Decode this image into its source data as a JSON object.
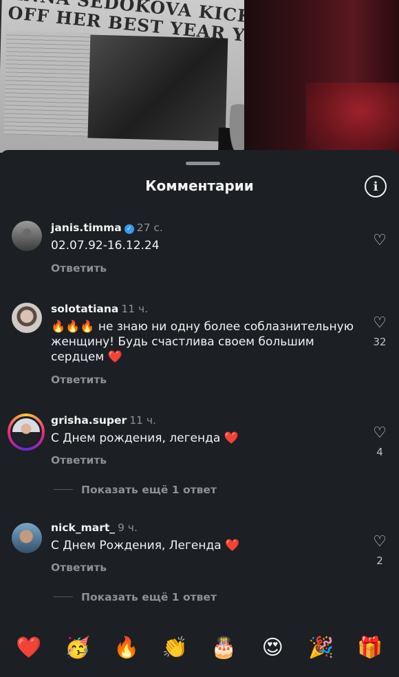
{
  "video": {
    "headline": "ANNA SEDOKOVA KICKS\nOFF HER BEST YEAR YET"
  },
  "sheet": {
    "title": "Комментарии",
    "info_icon": "info-icon"
  },
  "comments": [
    {
      "username": "janis.timma",
      "verified": true,
      "time": "27 с.",
      "text": "02.07.92-16.12.24",
      "reply_label": "Ответить",
      "likes": ""
    },
    {
      "username": "solotatiana",
      "verified": false,
      "time": "11 ч.",
      "text_prefix": "🔥🔥🔥",
      "text": " не знаю ни одну более соблазнительную женщину! Будь счастлива своем большим сердцем ",
      "text_suffix": "❤️",
      "reply_label": "Ответить",
      "likes": "32"
    },
    {
      "username": "grisha.super",
      "verified": false,
      "time": "11 ч.",
      "text": "С Днем рождения, легенда ",
      "text_suffix": "❤️",
      "reply_label": "Ответить",
      "likes": "4",
      "more_replies": "Показать ещё 1 ответ"
    },
    {
      "username": "nick_mart_",
      "verified": false,
      "time": "9 ч.",
      "text": "С Днем Рождения, Легенда ",
      "text_suffix": "❤️",
      "reply_label": "Ответить",
      "likes": "2",
      "more_replies": "Показать ещё 1 ответ"
    }
  ],
  "emoji_bar": [
    "❤️",
    "🥳",
    "🔥",
    "👏",
    "🎂",
    "😍",
    "🎉",
    "🎁"
  ]
}
